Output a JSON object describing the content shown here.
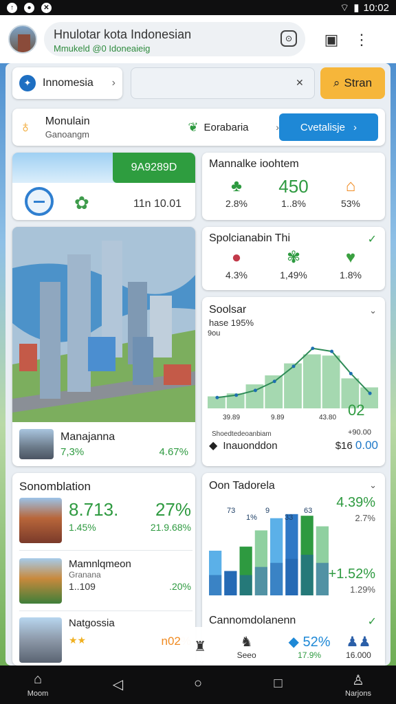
{
  "status_bar": {
    "time": "10:02"
  },
  "app_bar": {
    "title": "Hnulotar kota Indonesian",
    "subtitle": "Mmukeld @0 Idoneaieig"
  },
  "top": {
    "country_label": "Innomesia",
    "search_value": "",
    "start_label": "Stran"
  },
  "location": {
    "title": "Monulain",
    "subtitle": "Ganoangm",
    "area": "Eorabaria",
    "cta_label": "Cvetalisje"
  },
  "left_top": {
    "button_label": "9A9289D",
    "value": "11n 10.01"
  },
  "stats1": {
    "title": "Mannalke ioohtem",
    "big": "450",
    "values": [
      "2.8%",
      "1..8%",
      "53%"
    ]
  },
  "stats2": {
    "title": "Spolcianabin Thi",
    "values": [
      "4.3%",
      "1,49%",
      "1.8%"
    ]
  },
  "city": {
    "title": "Manajanna",
    "left_value": "7,3%",
    "right_value": "4.67%"
  },
  "chart_data": [
    {
      "type": "area",
      "title": "Soolsar",
      "subtitle": "hase 195%",
      "ylabel": "9ou",
      "x_labels": [
        "39.89",
        "9.89",
        "43.80"
      ],
      "footer_label": "Shoedtedeoanbiam",
      "callout_value": "02",
      "callout_label": "+90.00",
      "series": [
        {
          "values": [
            20,
            25,
            40,
            55,
            75,
            90,
            88,
            50,
            35
          ]
        },
        {
          "values": [
            18,
            22,
            30,
            45,
            70,
            100,
            95,
            58,
            25
          ]
        }
      ],
      "ylim": [
        0,
        110
      ]
    },
    {
      "type": "bar",
      "title": "Oon Tadorela",
      "data_labels": [
        "73",
        "1%",
        "9",
        "33",
        "63"
      ],
      "series": [
        {
          "values": [
            55,
            30,
            60,
            80,
            95,
            100,
            98,
            85
          ]
        },
        {
          "values": [
            25,
            30,
            25,
            35,
            40,
            45,
            50,
            40
          ]
        }
      ],
      "side_values": [
        "4.39%",
        "2.7%",
        "+1.52%",
        "1.29%"
      ],
      "ylim": [
        0,
        110
      ]
    }
  ],
  "info": {
    "label": "Inauonddon",
    "value_prefix": "$16",
    "value": "0.00"
  },
  "list": {
    "title": "Sonomblation",
    "items": [
      {
        "big_left": "8.713.",
        "big_right": "27%",
        "small_left": "1.45%",
        "small_right": "21.9.68%"
      },
      {
        "name": "Mamnlqmeon",
        "sub": "Granana",
        "small_left": "1..109",
        "small_right": ".20%"
      },
      {
        "name": "Natgossia",
        "stars": "★★",
        "small_right": "n02%"
      }
    ]
  },
  "bottom_card": {
    "title": "Cannomdolanenn"
  },
  "tabs": {
    "center_label": "Seeo",
    "value": "52%",
    "value_sub": "17.9%",
    "right_value": "16.000"
  },
  "nav": {
    "home_label": "Moom",
    "profile_label": "Narjons"
  }
}
